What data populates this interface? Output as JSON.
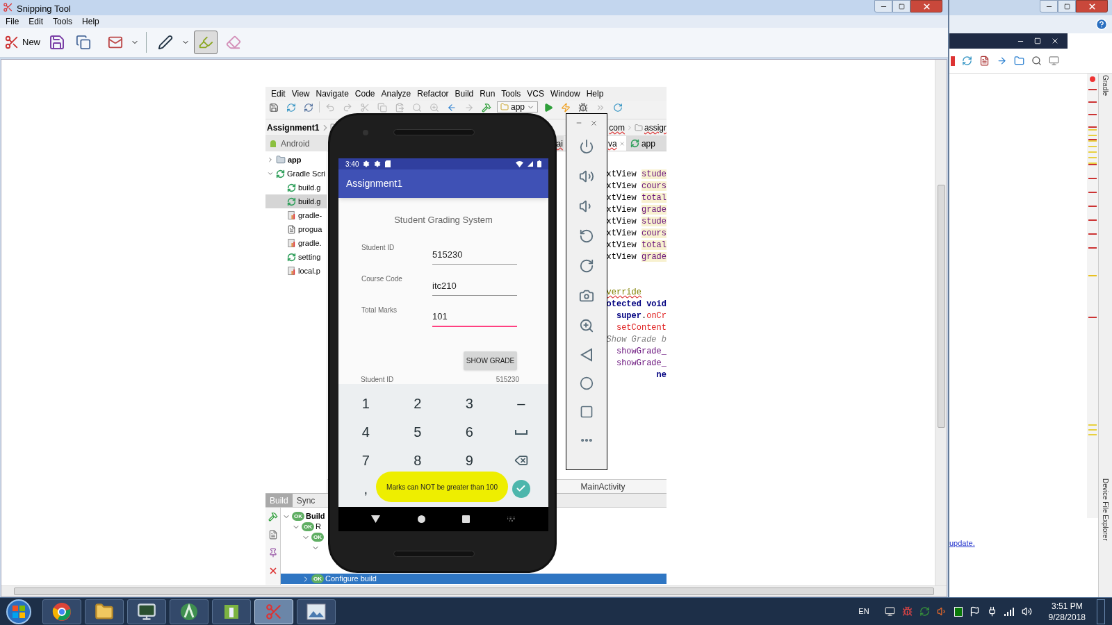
{
  "snipping_tool": {
    "title": "Snipping Tool",
    "menu": [
      "File",
      "Edit",
      "Tools",
      "Help"
    ],
    "new_label": "New",
    "tools": [
      {
        "kind": "pen",
        "selected": false
      },
      {
        "kind": "highlighter",
        "selected": true
      },
      {
        "kind": "eraser",
        "selected": false
      }
    ]
  },
  "ide": {
    "menu": [
      "Edit",
      "View",
      "Navigate",
      "Code",
      "Analyze",
      "Refactor",
      "Build",
      "Run",
      "Tools",
      "VCS",
      "Window",
      "Help"
    ],
    "run_config": "app",
    "project_crumb": "Assignment1",
    "path_crumbs": [
      "com",
      "assigr"
    ],
    "project_view": "Android",
    "tree": [
      {
        "label": "app",
        "kind": "module",
        "expanded": false,
        "selected": false
      },
      {
        "label": "Gradle Scri",
        "kind": "gradle",
        "expanded": true,
        "selected": false,
        "children": [
          {
            "label": "build.g",
            "kind": "gradle",
            "selected": false
          },
          {
            "label": "build.g",
            "kind": "gradle",
            "selected": true
          },
          {
            "label": "gradle-",
            "kind": "properties",
            "selected": false
          },
          {
            "label": "progua",
            "kind": "text",
            "selected": false
          },
          {
            "label": "gradle.",
            "kind": "properties",
            "selected": false
          },
          {
            "label": "setting",
            "kind": "gradle",
            "selected": false
          },
          {
            "label": "local.p",
            "kind": "properties",
            "selected": false
          }
        ]
      }
    ],
    "editor_tabs": [
      {
        "label": "ai",
        "kind": "file",
        "closable": false,
        "selected": false
      },
      {
        "label": "va",
        "kind": "file",
        "closable": true,
        "selected": true
      },
      {
        "label": "app",
        "kind": "gradle",
        "closable": false,
        "selected": false
      }
    ],
    "code_blocks": [
      [
        [
          {
            "text": "xtView ",
            "kind": "plain"
          },
          {
            "text": "stude",
            "kind": "field"
          }
        ],
        [
          {
            "text": "xtView ",
            "kind": "plain"
          },
          {
            "text": "cours",
            "kind": "field"
          }
        ],
        [
          {
            "text": "xtView ",
            "kind": "plain"
          },
          {
            "text": "total",
            "kind": "field"
          }
        ],
        [
          {
            "text": "xtView ",
            "kind": "plain"
          },
          {
            "text": "grade",
            "kind": "field"
          }
        ],
        [
          {
            "text": "xtView ",
            "kind": "plain"
          },
          {
            "text": "stude",
            "kind": "field"
          }
        ],
        [
          {
            "text": "xtView ",
            "kind": "plain"
          },
          {
            "text": "cours",
            "kind": "field"
          }
        ],
        [
          {
            "text": "xtView ",
            "kind": "plain"
          },
          {
            "text": "total",
            "kind": "field"
          }
        ],
        [
          {
            "text": "xtView ",
            "kind": "plain"
          },
          {
            "text": "grade",
            "kind": "field"
          }
        ]
      ],
      [
        [
          {
            "text": "verride",
            "kind": "annotation"
          }
        ],
        [
          {
            "text": "otected void",
            "kind": "keyword"
          }
        ],
        [
          {
            "text": "  super",
            "kind": "keyword"
          },
          {
            "text": ".",
            "kind": "plain"
          },
          {
            "text": "onCr",
            "kind": "method"
          }
        ],
        [
          {
            "text": "  setContent",
            "kind": "method"
          }
        ],
        [
          {
            "text": "Show Grade b",
            "kind": "comment"
          }
        ],
        [
          {
            "text": "  showGrade_",
            "kind": "member"
          }
        ],
        [
          {
            "text": "  showGrade_",
            "kind": "member"
          }
        ],
        [
          {
            "text": "          ne",
            "kind": "keyword"
          }
        ]
      ]
    ],
    "editor_footer": "MainActivity",
    "build_tabs": [
      {
        "label": "Build",
        "selected": true
      },
      {
        "label": "Sync",
        "selected": false
      }
    ],
    "build_tree": [
      {
        "label": "Build",
        "status": "OK",
        "expanded": true,
        "selected": false,
        "children": [
          {
            "label": "R",
            "status": "OK",
            "expanded": true,
            "selected": false,
            "children": [
              {
                "status": "OK",
                "expanded": true,
                "selected": false,
                "children": [
                  {
                    "expanded": true,
                    "selected": false
                  }
                ]
              },
              {
                "label": "Configure build",
                "status": "OK",
                "expanded": false,
                "selected": true
              }
            ]
          }
        ]
      }
    ]
  },
  "phone": {
    "time": "3:40",
    "app_title": "Assignment1",
    "heading": "Student Grading System",
    "fields": [
      {
        "label": "Student ID",
        "value": "515230",
        "focused": false
      },
      {
        "label": "Course Code",
        "value": "itc210",
        "focused": false
      },
      {
        "label": "Total Marks",
        "value": "101",
        "focused": true
      }
    ],
    "button": "SHOW GRADE",
    "result": {
      "label": "Student ID",
      "value": "515230"
    },
    "keypad": [
      {
        "kind": "char",
        "label": "1"
      },
      {
        "kind": "char",
        "label": "2"
      },
      {
        "kind": "char",
        "label": "3"
      },
      {
        "kind": "char",
        "label": "–"
      },
      {
        "kind": "char",
        "label": "4"
      },
      {
        "kind": "char",
        "label": "5"
      },
      {
        "kind": "char",
        "label": "6"
      },
      {
        "kind": "space"
      },
      {
        "kind": "char",
        "label": "7"
      },
      {
        "kind": "char",
        "label": "8"
      },
      {
        "kind": "char",
        "label": "9"
      },
      {
        "kind": "backspace"
      },
      {
        "kind": "char",
        "label": ","
      },
      {
        "kind": "blank"
      },
      {
        "kind": "blank"
      },
      {
        "kind": "done"
      }
    ],
    "toast": "Marks can NOT be greater than 100"
  },
  "background_window": {
    "link": "update.",
    "side_labels": [
      "Gradle",
      "Device File Explorer"
    ]
  },
  "taskbar": {
    "apps": [
      {
        "kind": "chrome",
        "active": false
      },
      {
        "kind": "explorer",
        "active": false
      },
      {
        "kind": "monitor",
        "active": false
      },
      {
        "kind": "android",
        "active": false
      },
      {
        "kind": "notes",
        "active": false
      },
      {
        "kind": "snipping",
        "active": true
      },
      {
        "kind": "image",
        "active": false
      }
    ],
    "language": "EN",
    "time": "3:51 PM",
    "date": "9/28/2018"
  }
}
